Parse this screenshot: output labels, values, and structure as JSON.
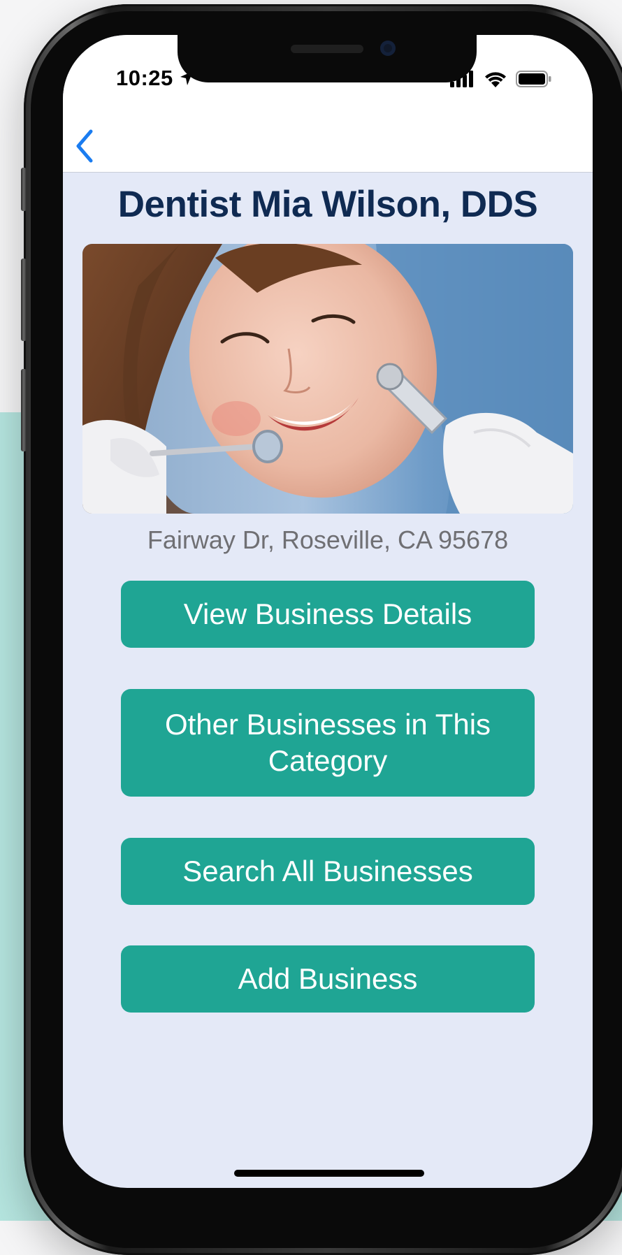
{
  "status_bar": {
    "time": "10:25"
  },
  "nav": {
    "back_icon": "chevron-left-icon"
  },
  "business": {
    "title": "Dentist Mia Wilson, DDS",
    "address": "Fairway Dr, Roseville, CA 95678"
  },
  "actions": {
    "view_details": "View Business Details",
    "other_category": "Other Businesses in This Category",
    "search_all": "Search All Businesses",
    "add_business": "Add Business"
  },
  "colors": {
    "accent": "#1fa594",
    "title": "#0f2a52",
    "ios_blue": "#1a7cf0",
    "screen_bg": "#e4e9f7"
  }
}
